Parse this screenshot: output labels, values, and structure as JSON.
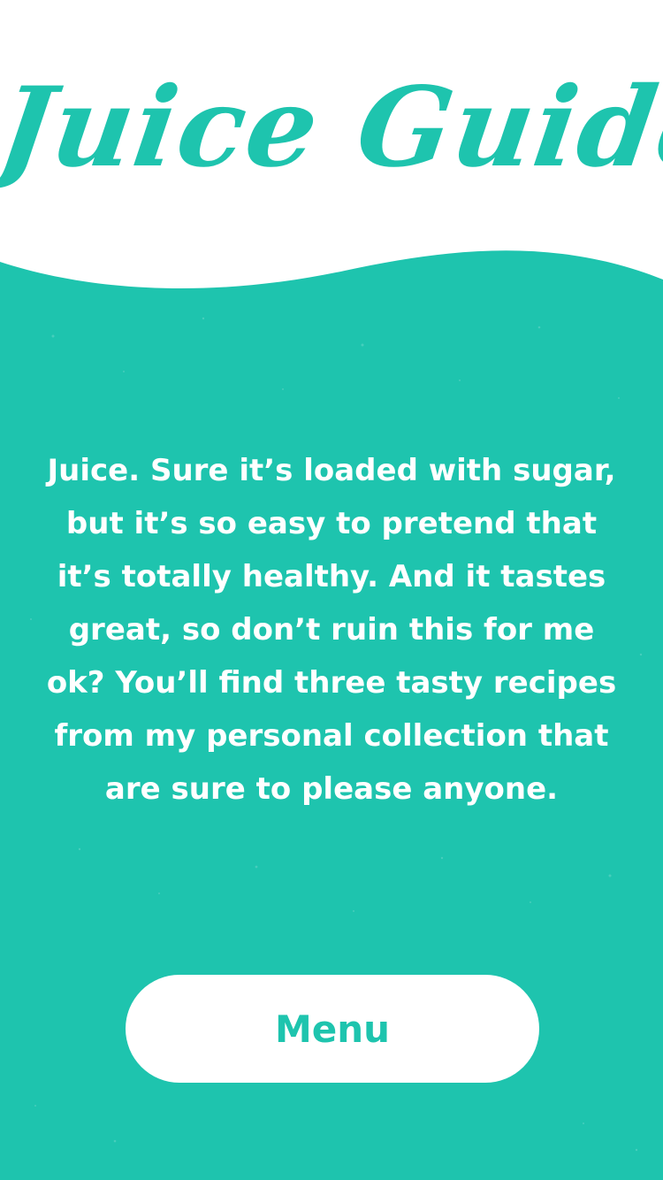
{
  "header": {
    "title": "Juice Guide",
    "title_icon": "juice-guide-script-logo"
  },
  "main": {
    "intro_text": "Juice. Sure it’s loaded with sugar, but it’s so easy to pretend that it’s totally healthy. And it tastes great, so don’t ruin this for me ok? You’ll find three tasty recipes from my personal collection that are sure to please anyone.",
    "menu_button_label": "Menu"
  },
  "colors": {
    "brand_teal": "#1ec4ae",
    "background_white": "#ffffff",
    "text_on_teal": "#ffffff"
  }
}
